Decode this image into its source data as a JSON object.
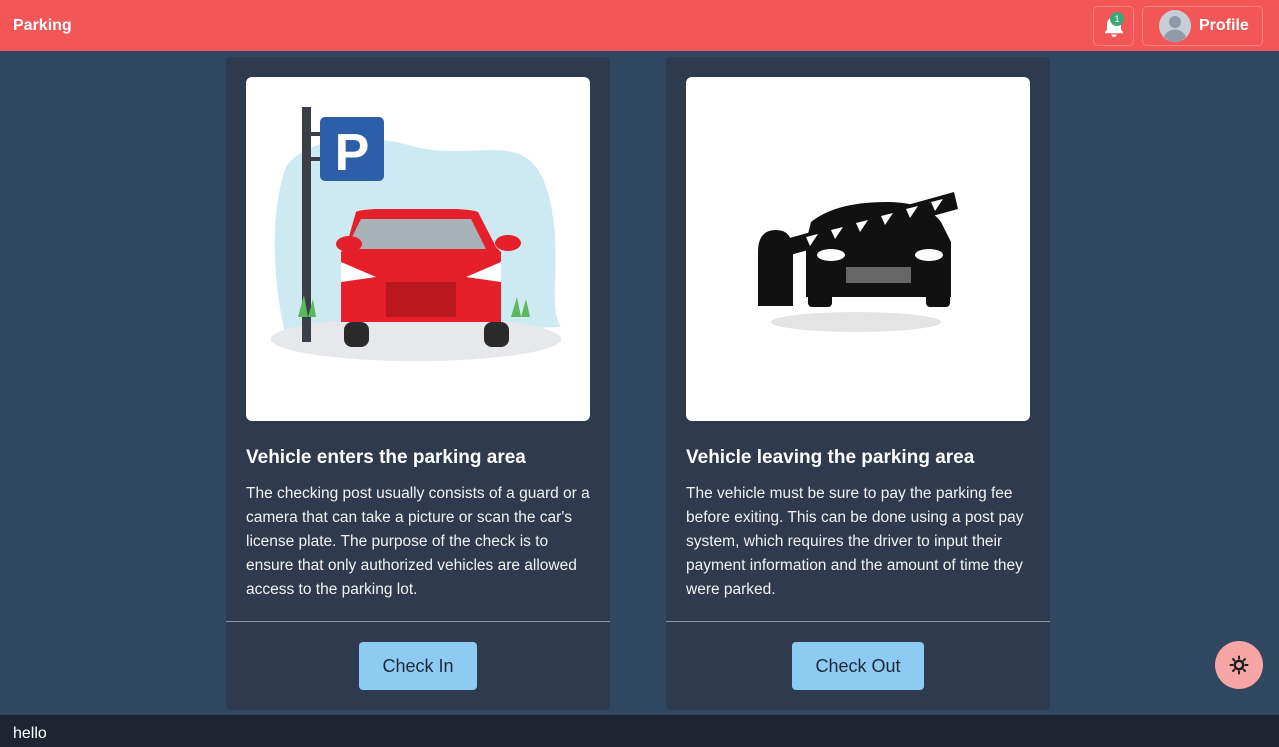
{
  "navbar": {
    "brand": "Parking",
    "notification_count": "1",
    "profile_label": "Profile",
    "bell_icon": "bell-icon",
    "avatar_icon": "user-avatar-icon"
  },
  "cards": [
    {
      "title": "Vehicle enters the parking area",
      "text": "The checking post usually consists of a guard or a camera that can take a picture or scan the car's license plate. The purpose of the check is to ensure that only authorized vehicles are allowed access to the parking lot.",
      "button_label": "Check In",
      "image": "parking-sign-red-car-illustration"
    },
    {
      "title": "Vehicle leaving the parking area",
      "text": "The vehicle must be sure to pay the parking fee before exiting. This can be done using a post pay system, which requires the driver to input their payment information and the amount of time they were parked.",
      "button_label": "Check Out",
      "image": "car-barrier-gate-illustration"
    }
  ],
  "theme_toggle_icon": "sun-icon",
  "footer": {
    "text": "hello"
  },
  "colors": {
    "navbar": "#f25656",
    "background": "#2f4761",
    "card": "#2e3a4d",
    "button": "#8ecbf3",
    "fab": "#f8a5a5",
    "footer": "#1e2531"
  }
}
